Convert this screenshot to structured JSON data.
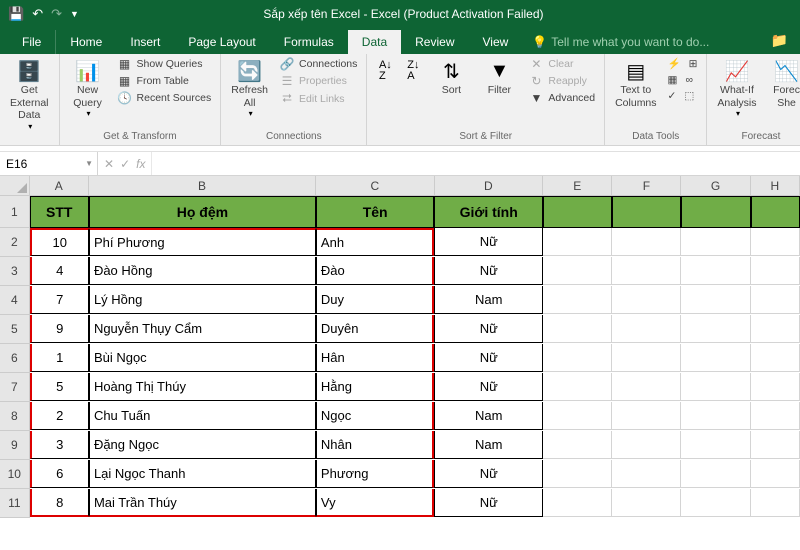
{
  "title": "Sắp xếp tên Excel - Excel (Product Activation Failed)",
  "tabs": {
    "file": "File",
    "home": "Home",
    "insert": "Insert",
    "pagelayout": "Page Layout",
    "formulas": "Formulas",
    "data": "Data",
    "review": "Review",
    "view": "View"
  },
  "tellme": "Tell me what you want to do...",
  "ribbon": {
    "getdata": {
      "big": "Get External\nData",
      "label": ""
    },
    "gettransform": {
      "newquery": "New\nQuery",
      "show": "Show Queries",
      "from": "From Table",
      "recent": "Recent Sources",
      "label": "Get & Transform"
    },
    "connections": {
      "refresh": "Refresh\nAll",
      "conn": "Connections",
      "prop": "Properties",
      "edit": "Edit Links",
      "label": "Connections"
    },
    "sortfilter": {
      "sort": "Sort",
      "filter": "Filter",
      "clear": "Clear",
      "reapply": "Reapply",
      "advanced": "Advanced",
      "label": "Sort & Filter"
    },
    "datatools": {
      "text": "Text to\nColumns",
      "label": "Data Tools"
    },
    "forecast": {
      "whatif": "What-If\nAnalysis",
      "sheet": "Forec\nShe",
      "label": "Forecast"
    }
  },
  "namebox": "E16",
  "colheads": [
    "A",
    "B",
    "C",
    "D",
    "E",
    "F",
    "G",
    "H"
  ],
  "table": {
    "headers": {
      "stt": "STT",
      "hodem": "Họ đệm",
      "ten": "Tên",
      "gioitinh": "Giới tính"
    },
    "rows": [
      {
        "stt": "10",
        "hodem": "Phí Phương",
        "ten": "Anh",
        "gt": "Nữ"
      },
      {
        "stt": "4",
        "hodem": "Đào Hồng",
        "ten": "Đào",
        "gt": "Nữ"
      },
      {
        "stt": "7",
        "hodem": "Lý Hồng",
        "ten": "Duy",
        "gt": "Nam"
      },
      {
        "stt": "9",
        "hodem": "Nguyễn Thụy Cẩm",
        "ten": "Duyên",
        "gt": "Nữ"
      },
      {
        "stt": "1",
        "hodem": "Bùi Ngọc",
        "ten": "Hân",
        "gt": "Nữ"
      },
      {
        "stt": "5",
        "hodem": "Hoàng Thị Thúy",
        "ten": "Hằng",
        "gt": "Nữ"
      },
      {
        "stt": "2",
        "hodem": "Chu Tuấn",
        "ten": "Ngọc",
        "gt": "Nam"
      },
      {
        "stt": "3",
        "hodem": "Đặng Ngọc",
        "ten": "Nhân",
        "gt": "Nam"
      },
      {
        "stt": "6",
        "hodem": "Lại Ngọc Thanh",
        "ten": "Phương",
        "gt": "Nữ"
      },
      {
        "stt": "8",
        "hodem": "Mai Trần Thúy",
        "ten": "Vy",
        "gt": "Nữ"
      }
    ]
  }
}
